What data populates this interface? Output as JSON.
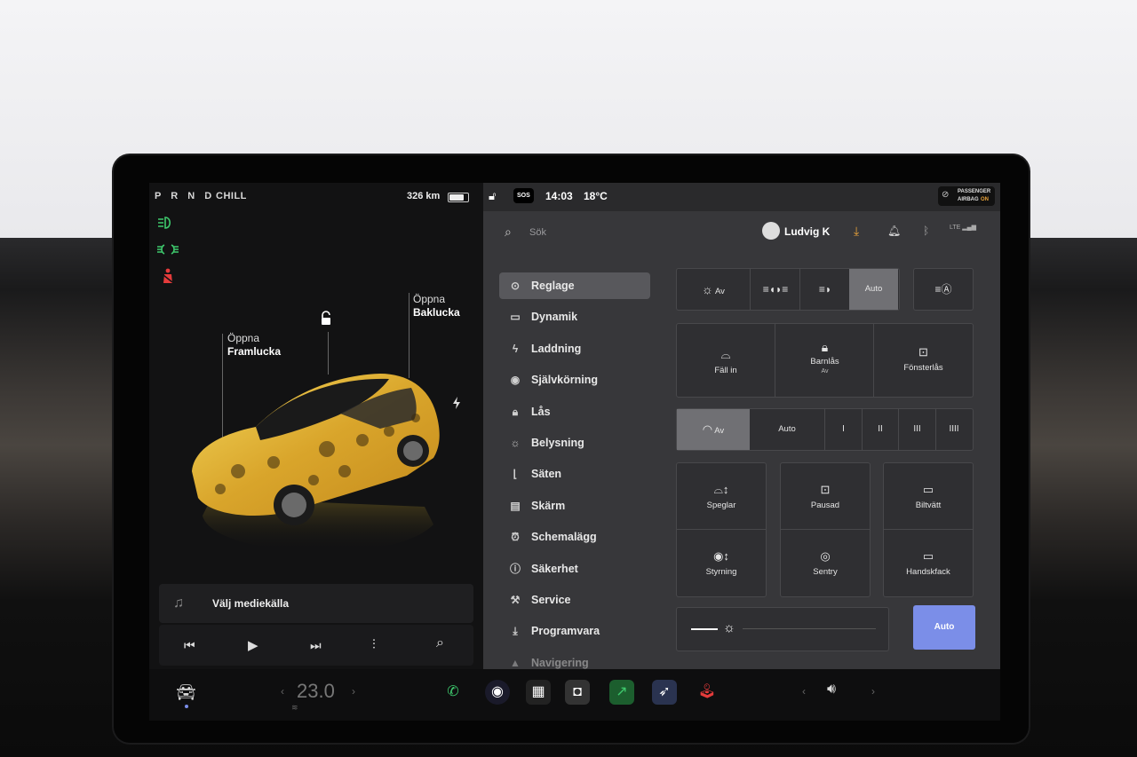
{
  "status_left": {
    "gear": "P R N D",
    "mode": "CHILL",
    "range": "326 km",
    "battery_fraction": 0.78
  },
  "status_right": {
    "sos": "SOS",
    "time": "14:03",
    "temp": "18°C",
    "airbag_line1": "PASSENGER",
    "airbag_line2": "AIRBAG",
    "airbag_state": "ON"
  },
  "left_panel": {
    "indicators": [
      "headlight-icon",
      "parking-light-icon",
      "seatbelt-warning-icon"
    ],
    "front_trunk": {
      "line1": "Öppna",
      "line2": "Framlucka"
    },
    "rear_trunk": {
      "line1": "Öppna",
      "line2": "Baklucka"
    },
    "media_source": "Välj mediekälla"
  },
  "header": {
    "search_placeholder": "Sök",
    "user": "Ludvig K"
  },
  "menu": [
    {
      "label": "Reglage",
      "icon": "toggle-icon",
      "active": true
    },
    {
      "label": "Dynamik",
      "icon": "car-icon"
    },
    {
      "label": "Laddning",
      "icon": "bolt-icon"
    },
    {
      "label": "Självkörning",
      "icon": "steering-wheel-icon"
    },
    {
      "label": "Lås",
      "icon": "lock-icon"
    },
    {
      "label": "Belysning",
      "icon": "sun-icon"
    },
    {
      "label": "Säten",
      "icon": "seat-icon"
    },
    {
      "label": "Skärm",
      "icon": "display-icon"
    },
    {
      "label": "Schemalägg",
      "icon": "alarm-clock-icon"
    },
    {
      "label": "Säkerhet",
      "icon": "alert-circle-icon"
    },
    {
      "label": "Service",
      "icon": "wrench-icon"
    },
    {
      "label": "Programvara",
      "icon": "download-icon"
    },
    {
      "label": "Navigering",
      "icon": "navigation-icon"
    }
  ],
  "lights": {
    "off": "Av",
    "auto": "Auto"
  },
  "mirrors_row": {
    "fold": "Fäll in",
    "child_lock": "Barnlås",
    "child_lock_state": "Av",
    "window_lock": "Fönsterlås"
  },
  "wipers": {
    "off": "Av",
    "auto": "Auto",
    "speeds": [
      "I",
      "II",
      "III",
      "IIII"
    ]
  },
  "grid": {
    "mirrors": "Speglar",
    "dashcam": "Pausad",
    "carwash": "Biltvätt",
    "steering": "Styrning",
    "sentry": "Sentry",
    "glovebox": "Handskfack"
  },
  "brightness": {
    "auto": "Auto"
  },
  "dock": {
    "temp": "23.0"
  },
  "colors": {
    "accent": "#7b8ee8",
    "active_tab": "#58585c",
    "download": "#e8a23a",
    "green": "#3ec96d",
    "red": "#e53b3b"
  }
}
